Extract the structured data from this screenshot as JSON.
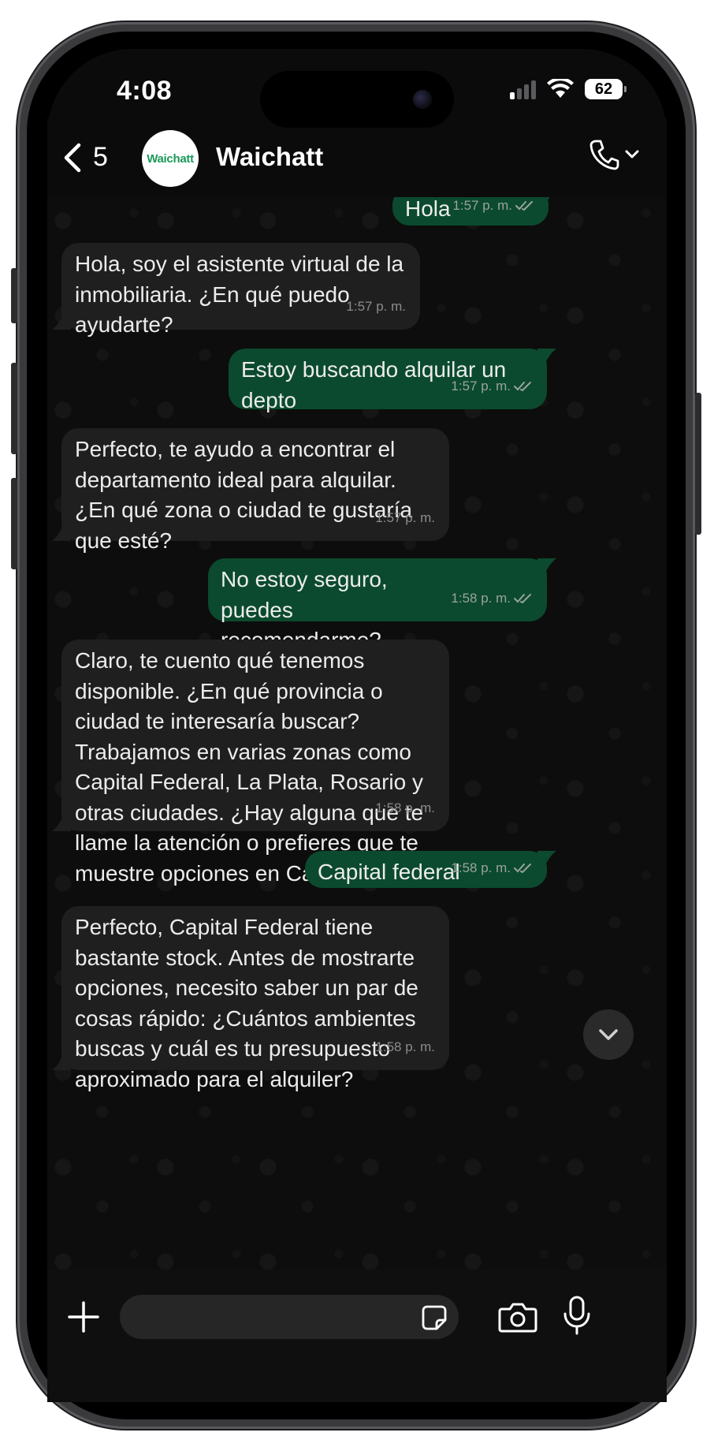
{
  "status_bar": {
    "time": "4:08",
    "battery": "62"
  },
  "header": {
    "back_count": "5",
    "avatar_text": "Waichatt",
    "contact_name": "Waichatt"
  },
  "messages": [
    {
      "dir": "out",
      "text": "Hola",
      "time": "1:57 p. m.",
      "ticks": "double-check-icon"
    },
    {
      "dir": "in",
      "text": "Hola, soy el asistente virtual de la inmobiliaria. ¿En qué puedo ayudarte?",
      "time": "1:57 p. m."
    },
    {
      "dir": "out",
      "text": "Estoy buscando alquilar un depto",
      "time": "1:57 p. m.",
      "ticks": "double-check-icon"
    },
    {
      "dir": "in",
      "text": "Perfecto, te ayudo a encontrar el departamento ideal para alquilar. ¿En qué zona o ciudad te gustaría que esté?",
      "time": "1:57 p. m."
    },
    {
      "dir": "out",
      "text": "No estoy seguro, puedes recomendarme?",
      "time": "1:58 p. m.",
      "ticks": "double-check-icon"
    },
    {
      "dir": "in",
      "text": "Claro, te cuento qué tenemos disponible. ¿En qué provincia o ciudad te interesaría buscar? Trabajamos en varias zonas como Capital Federal, La Plata, Rosario y otras ciudades. ¿Hay alguna que te llame la atención o prefieres que te muestre opciones en Capital?",
      "time": "1:58 p. m."
    },
    {
      "dir": "out",
      "text": "Capital federal",
      "time": "1:58 p. m.",
      "ticks": "double-check-icon"
    },
    {
      "dir": "in",
      "text": "Perfecto, Capital Federal tiene bastante stock. Antes de mostrarte opciones, necesito saber un par de cosas rápido: ¿Cuántos ambientes buscas y cuál es tu presupuesto aproximado para el alquiler?",
      "time": "1:58 p. m."
    }
  ],
  "composer": {
    "input_value": "",
    "input_placeholder": ""
  },
  "colors": {
    "outgoing_bubble": "#0b4a2e",
    "incoming_bubble": "#1f1f1f",
    "background": "#0d0d0d"
  }
}
